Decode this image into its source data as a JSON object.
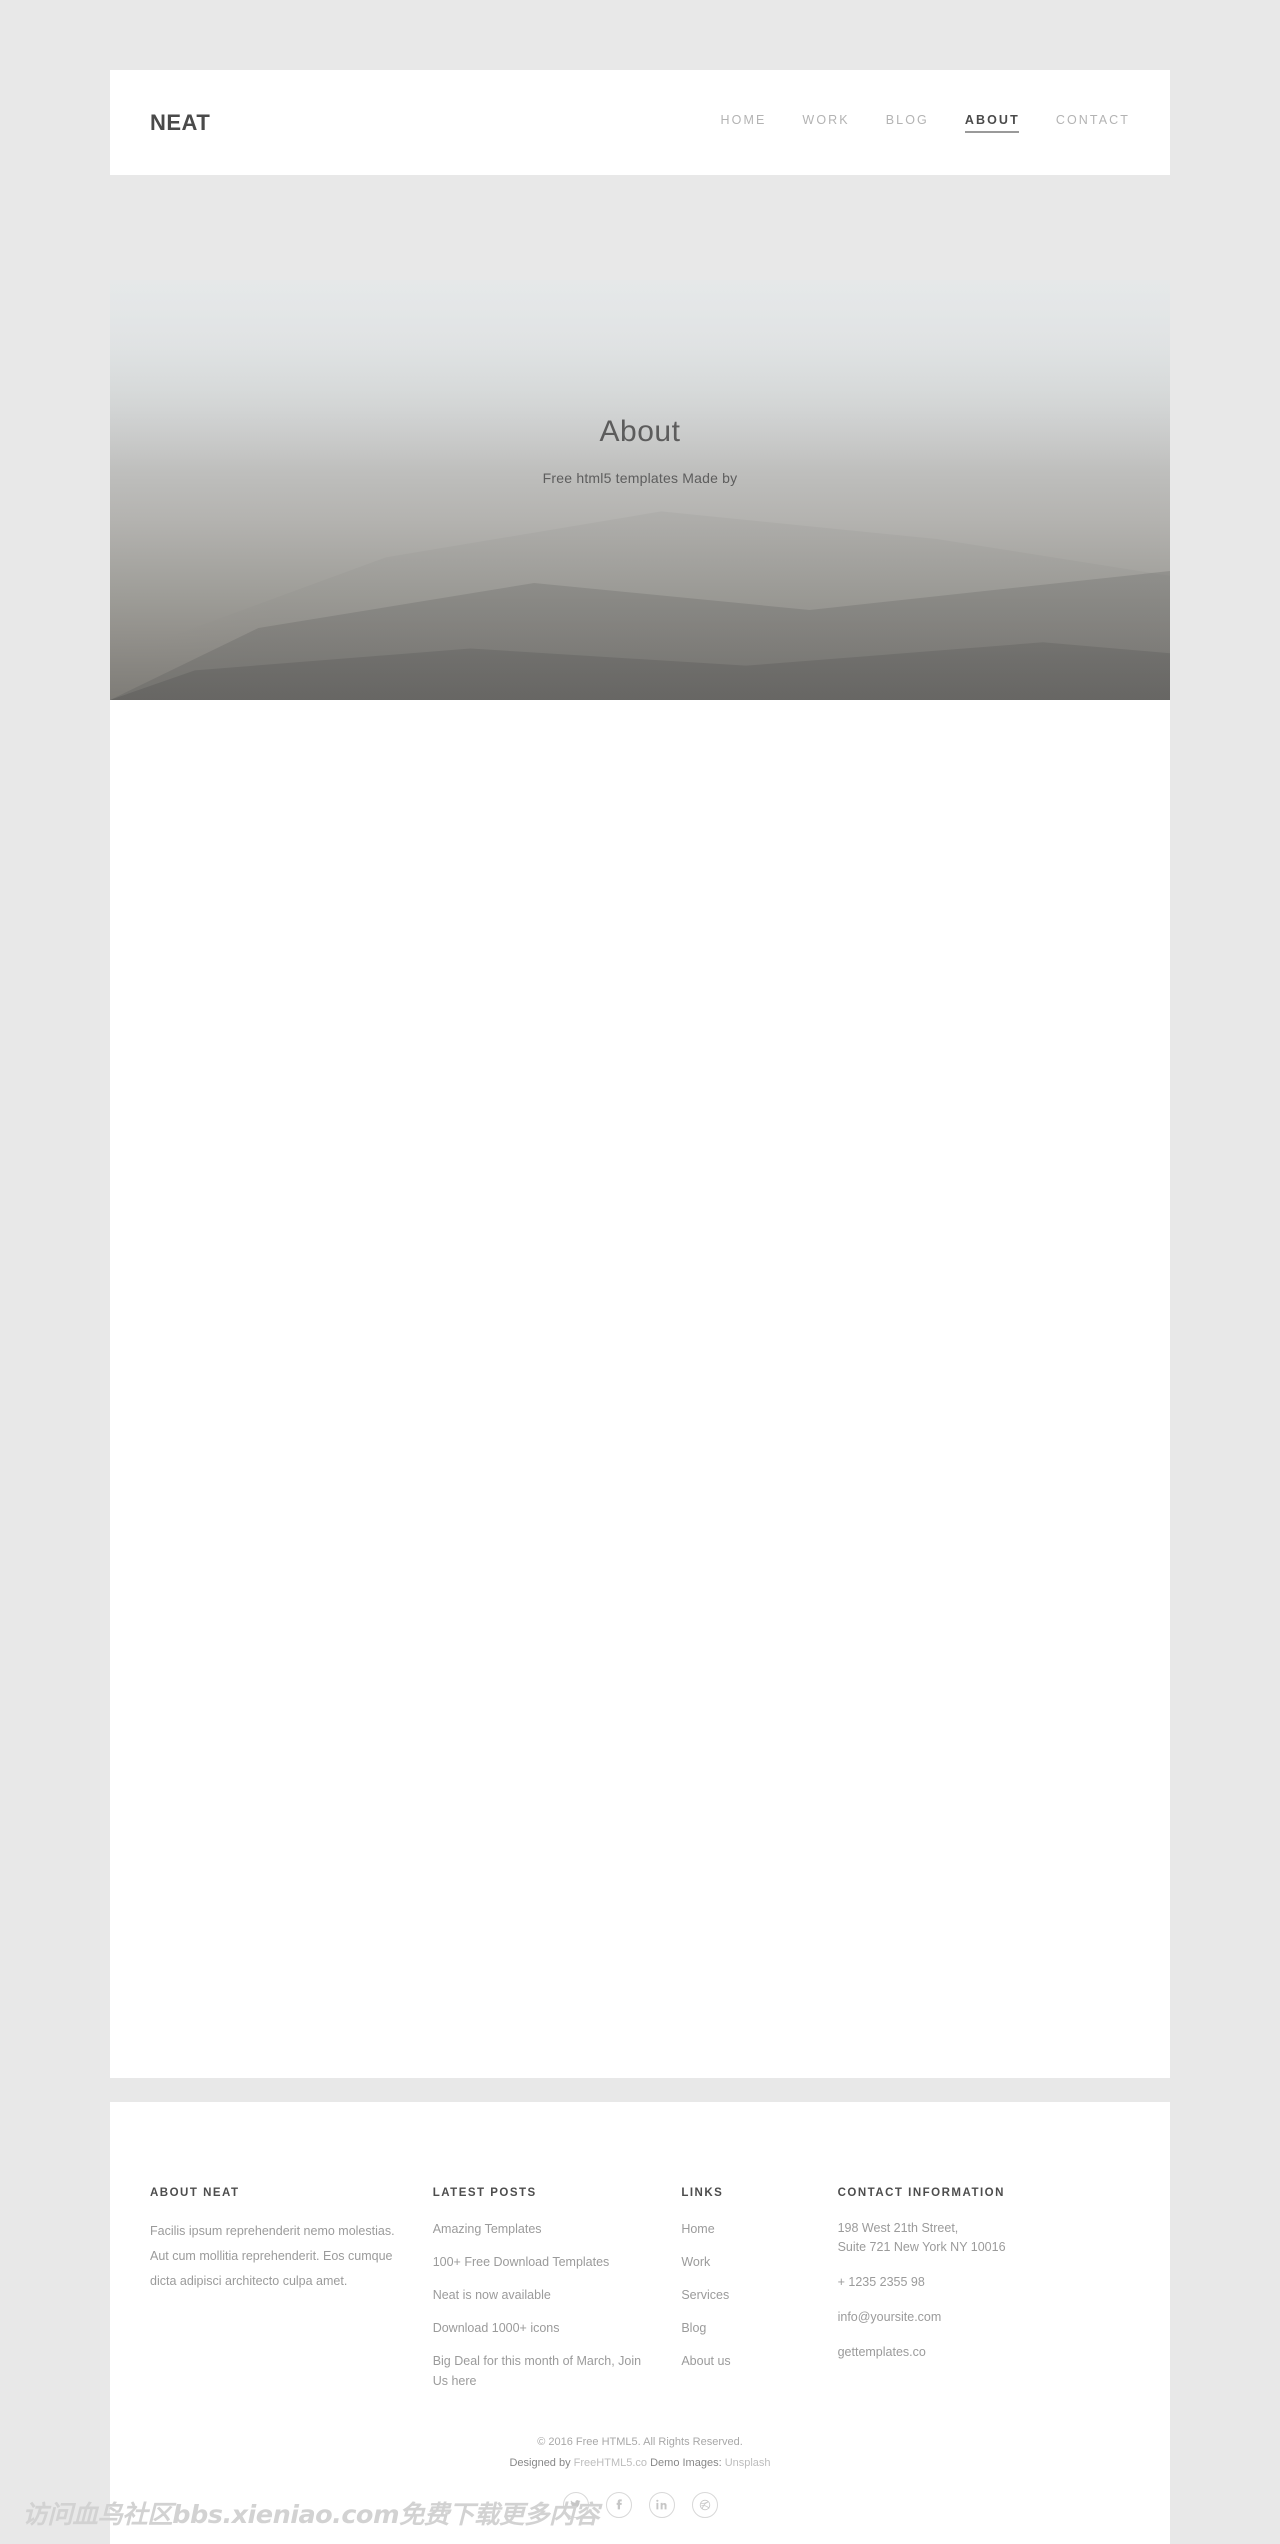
{
  "brand": "NEAT",
  "nav": {
    "items": [
      {
        "label": "HOME",
        "active": false
      },
      {
        "label": "WORK",
        "active": false
      },
      {
        "label": "BLOG",
        "active": false
      },
      {
        "label": "ABOUT",
        "active": true
      },
      {
        "label": "CONTACT",
        "active": false
      }
    ]
  },
  "hero": {
    "title": "About",
    "subtitle": "Free html5 templates Made by"
  },
  "footer": {
    "about": {
      "heading": "ABOUT NEAT",
      "text": "Facilis ipsum reprehenderit nemo molestias. Aut cum mollitia reprehenderit. Eos cumque dicta adipisci architecto culpa amet."
    },
    "latest_posts": {
      "heading": "LATEST POSTS",
      "items": [
        "Amazing Templates",
        "100+ Free Download Templates",
        "Neat is now available",
        "Download 1000+ icons",
        "Big Deal for this month of March, Join Us here"
      ]
    },
    "links": {
      "heading": "LINKS",
      "items": [
        "Home",
        "Work",
        "Services",
        "Blog",
        "About us"
      ]
    },
    "contact": {
      "heading": "CONTACT INFORMATION",
      "address_line1": "198 West 21th Street,",
      "address_line2": "Suite 721 New York NY 10016",
      "phone": "+ 1235 2355 98",
      "email": "info@yoursite.com",
      "website": "gettemplates.co"
    },
    "copyright": "© 2016 Free HTML5. All Rights Reserved.",
    "credits": {
      "designed_by_label": "Designed by",
      "designed_by_link": "FreeHTML5.co",
      "demo_images_label": "Demo Images:",
      "demo_images_link": "Unsplash"
    },
    "social": [
      {
        "name": "twitter-icon",
        "glyph": "t"
      },
      {
        "name": "facebook-icon",
        "glyph": "f"
      },
      {
        "name": "linkedin-icon",
        "glyph": "in"
      },
      {
        "name": "dribbble-icon",
        "glyph": "ⓓ"
      }
    ]
  },
  "watermark": "访问血鸟社区bbs.xieniao.com免费下载更多内容",
  "colors": {
    "page_bg": "#e8e8e8",
    "card_bg": "#ffffff",
    "brand_text": "#4a4a4a",
    "nav_inactive": "#b3b3b3",
    "nav_active": "#4a4a4a",
    "hero_text": "#5c5c5c",
    "footer_heading": "#4d4d4d",
    "footer_body": "#9b9b9b"
  }
}
